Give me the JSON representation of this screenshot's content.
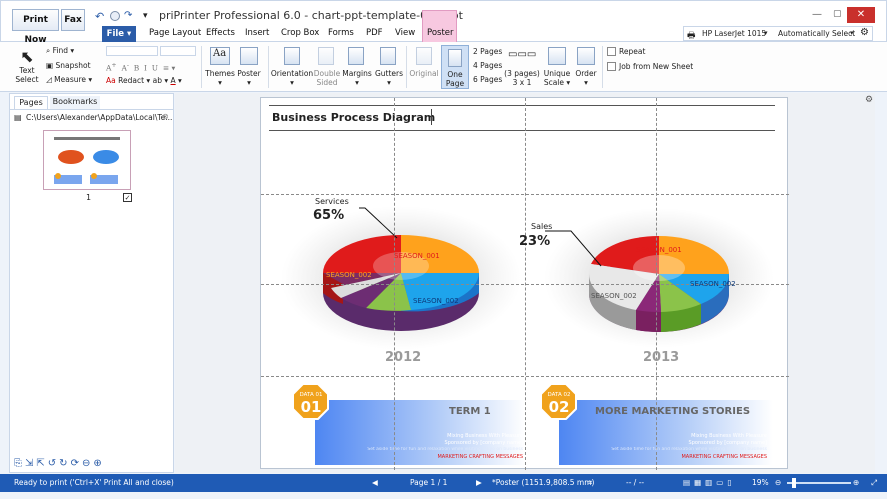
{
  "app": {
    "title": "priPrinter Professional 6.0 - chart-ppt-template-008.ppt"
  },
  "quick": {
    "print_now": "Print Now",
    "fax": "Fax"
  },
  "menu": {
    "file": "File",
    "page_layout": "Page Layout",
    "effects": "Effects",
    "insert": "Insert",
    "crop_box": "Crop Box",
    "forms": "Forms",
    "pdf": "PDF",
    "view": "View",
    "poster": "Poster"
  },
  "printer": {
    "name": "HP LaserJet 1015",
    "select_mode": "Automatically Select"
  },
  "ribbon": {
    "text_select": "Text Select",
    "find": "Find",
    "snapshot": "Snapshot",
    "measure": "Measure",
    "redact": "Redact",
    "themes": "Themes",
    "poster": "Poster",
    "orientation": "Orientation",
    "double_sided": "Double Sided",
    "margins": "Margins",
    "gutters": "Gutters",
    "original": "Original",
    "one_page": "One Page",
    "two_pages": "2 Pages",
    "four_pages": "4 Pages",
    "six_pages": "6 Pages",
    "three_pages": "(3 pages) 3 x 1",
    "unique_scale": "Unique Scale",
    "order": "Order",
    "repeat": "Repeat",
    "job_new_sheet": "Job from New Sheet"
  },
  "panel": {
    "tab_pages": "Pages",
    "tab_bookmarks": "Bookmarks",
    "path": "C:\\Users\\Alexander\\AppData\\Local\\Te...",
    "page_num": "1"
  },
  "slide": {
    "title": "Business Process Diagram",
    "left": {
      "label": "Services",
      "pct": "65%",
      "year": "2012",
      "s1": "SEASON_001",
      "s2": "SEASON_002",
      "s3": "SEASON_002"
    },
    "right": {
      "label": "Sales",
      "pct": "23%",
      "year": "2013",
      "s1": "SEASON_001",
      "s2": "SEASON_002",
      "s3": "SEASON_002"
    },
    "box1": {
      "badge_small": "DATA 01",
      "badge_big": "01",
      "heading": "TERM 1",
      "line1": "Mixing Business With Pleasure",
      "line2": "Sponsored by [company name]",
      "line3": "Set aside time for fun and relaxation while visiting Tokyo on business",
      "line4": "MARKETING CRAFTING MESSAGES"
    },
    "box2": {
      "badge_small": "DATA 02",
      "badge_big": "02",
      "heading": "MORE MARKETING STORIES",
      "line1": "Mixing Business With Pleasure",
      "line2": "Sponsored by [company name]",
      "line3": "Set aside time for fun and relaxation while visiting Tokyo on business",
      "line4": "MARKETING CRAFTING MESSAGES"
    }
  },
  "status": {
    "ready": "Ready to print ('Ctrl+X' Print All and close)",
    "page": "Page 1 / 1",
    "poster": "*Poster (1151.9,808.5 mm)",
    "coords": "-- / --",
    "zoom": "19%"
  },
  "colors": {
    "accent": "#1f5bb5",
    "poster_tab": "#f7c8e0",
    "badge": "#f0a21c"
  }
}
